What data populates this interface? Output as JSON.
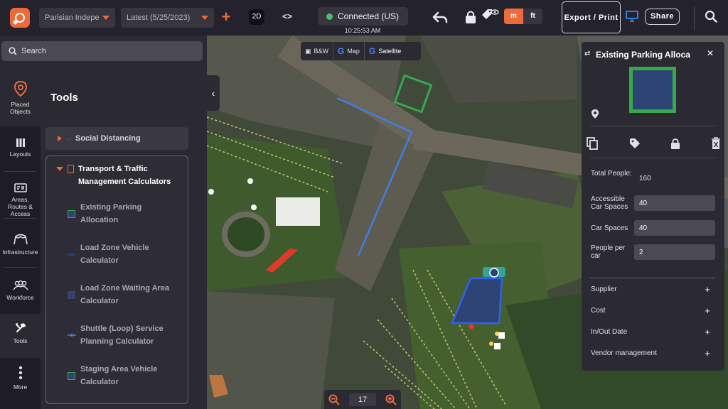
{
  "topbar": {
    "project": "Parisian Indepe",
    "version": "Latest (5/25/2023)",
    "view_mode": "2D",
    "code_symbol": "<>",
    "connection": "Connected (US)",
    "time": "10:25:53 AM",
    "unit_m": "m",
    "unit_ft": "ft",
    "export_label": "Export / Print",
    "share_label": "Share"
  },
  "search": {
    "placeholder": "Search"
  },
  "rail": [
    {
      "label": "Placed Objects",
      "icon": "location-pin-icon",
      "active": true
    },
    {
      "label": "Layouts",
      "icon": "layouts-icon"
    },
    {
      "label": "Areas, Routes & Access",
      "icon": "map-icon"
    },
    {
      "label": "Infrastructure",
      "icon": "tent-icon"
    },
    {
      "label": "Workforce",
      "icon": "people-icon"
    },
    {
      "label": "Tools",
      "icon": "wrench-icon"
    },
    {
      "label": "More",
      "icon": "more-vertical-icon"
    }
  ],
  "tools": {
    "title": "Tools",
    "social_distancing": "Social Distancing",
    "group_title_1": "Transport & Traffic",
    "group_title_2": "Management Calculators",
    "items": [
      {
        "line1": "Existing Parking",
        "line2": "Allocation",
        "icon": "square-green-icon"
      },
      {
        "line1": "Load Zone Vehicle",
        "line2": "Calculator",
        "icon": "line-blue-icon"
      },
      {
        "line1": "Load Zone Waiting Area",
        "line2": "Calculator",
        "icon": "square-blue-icon"
      },
      {
        "line1": "Shuttle (Loop) Service",
        "line2": "Planning Calculator",
        "icon": "route-line-icon"
      },
      {
        "line1": "Staging Area Vehicle",
        "line2": "Calculator",
        "icon": "square-green-icon"
      }
    ]
  },
  "map": {
    "types": [
      "B&W",
      "Map",
      "Satellite"
    ],
    "zoom": "17"
  },
  "properties": {
    "title": "Existing Parking Alloca",
    "total_people_label": "Total People:",
    "total_people_value": "160",
    "accessible_label": "Accessible Car Spaces",
    "accessible_value": "40",
    "car_spaces_label": "Car Spaces",
    "car_spaces_value": "40",
    "people_per_car_label": "People per car",
    "people_per_car_value": "2",
    "expandables": [
      "Supplier",
      "Cost",
      "In/Out Date",
      "Vendor management"
    ]
  },
  "colors": {
    "accent": "#ee6a3b",
    "connected": "#48c26a",
    "swatch_fill": "#2d4373",
    "swatch_border": "#36a94a"
  }
}
